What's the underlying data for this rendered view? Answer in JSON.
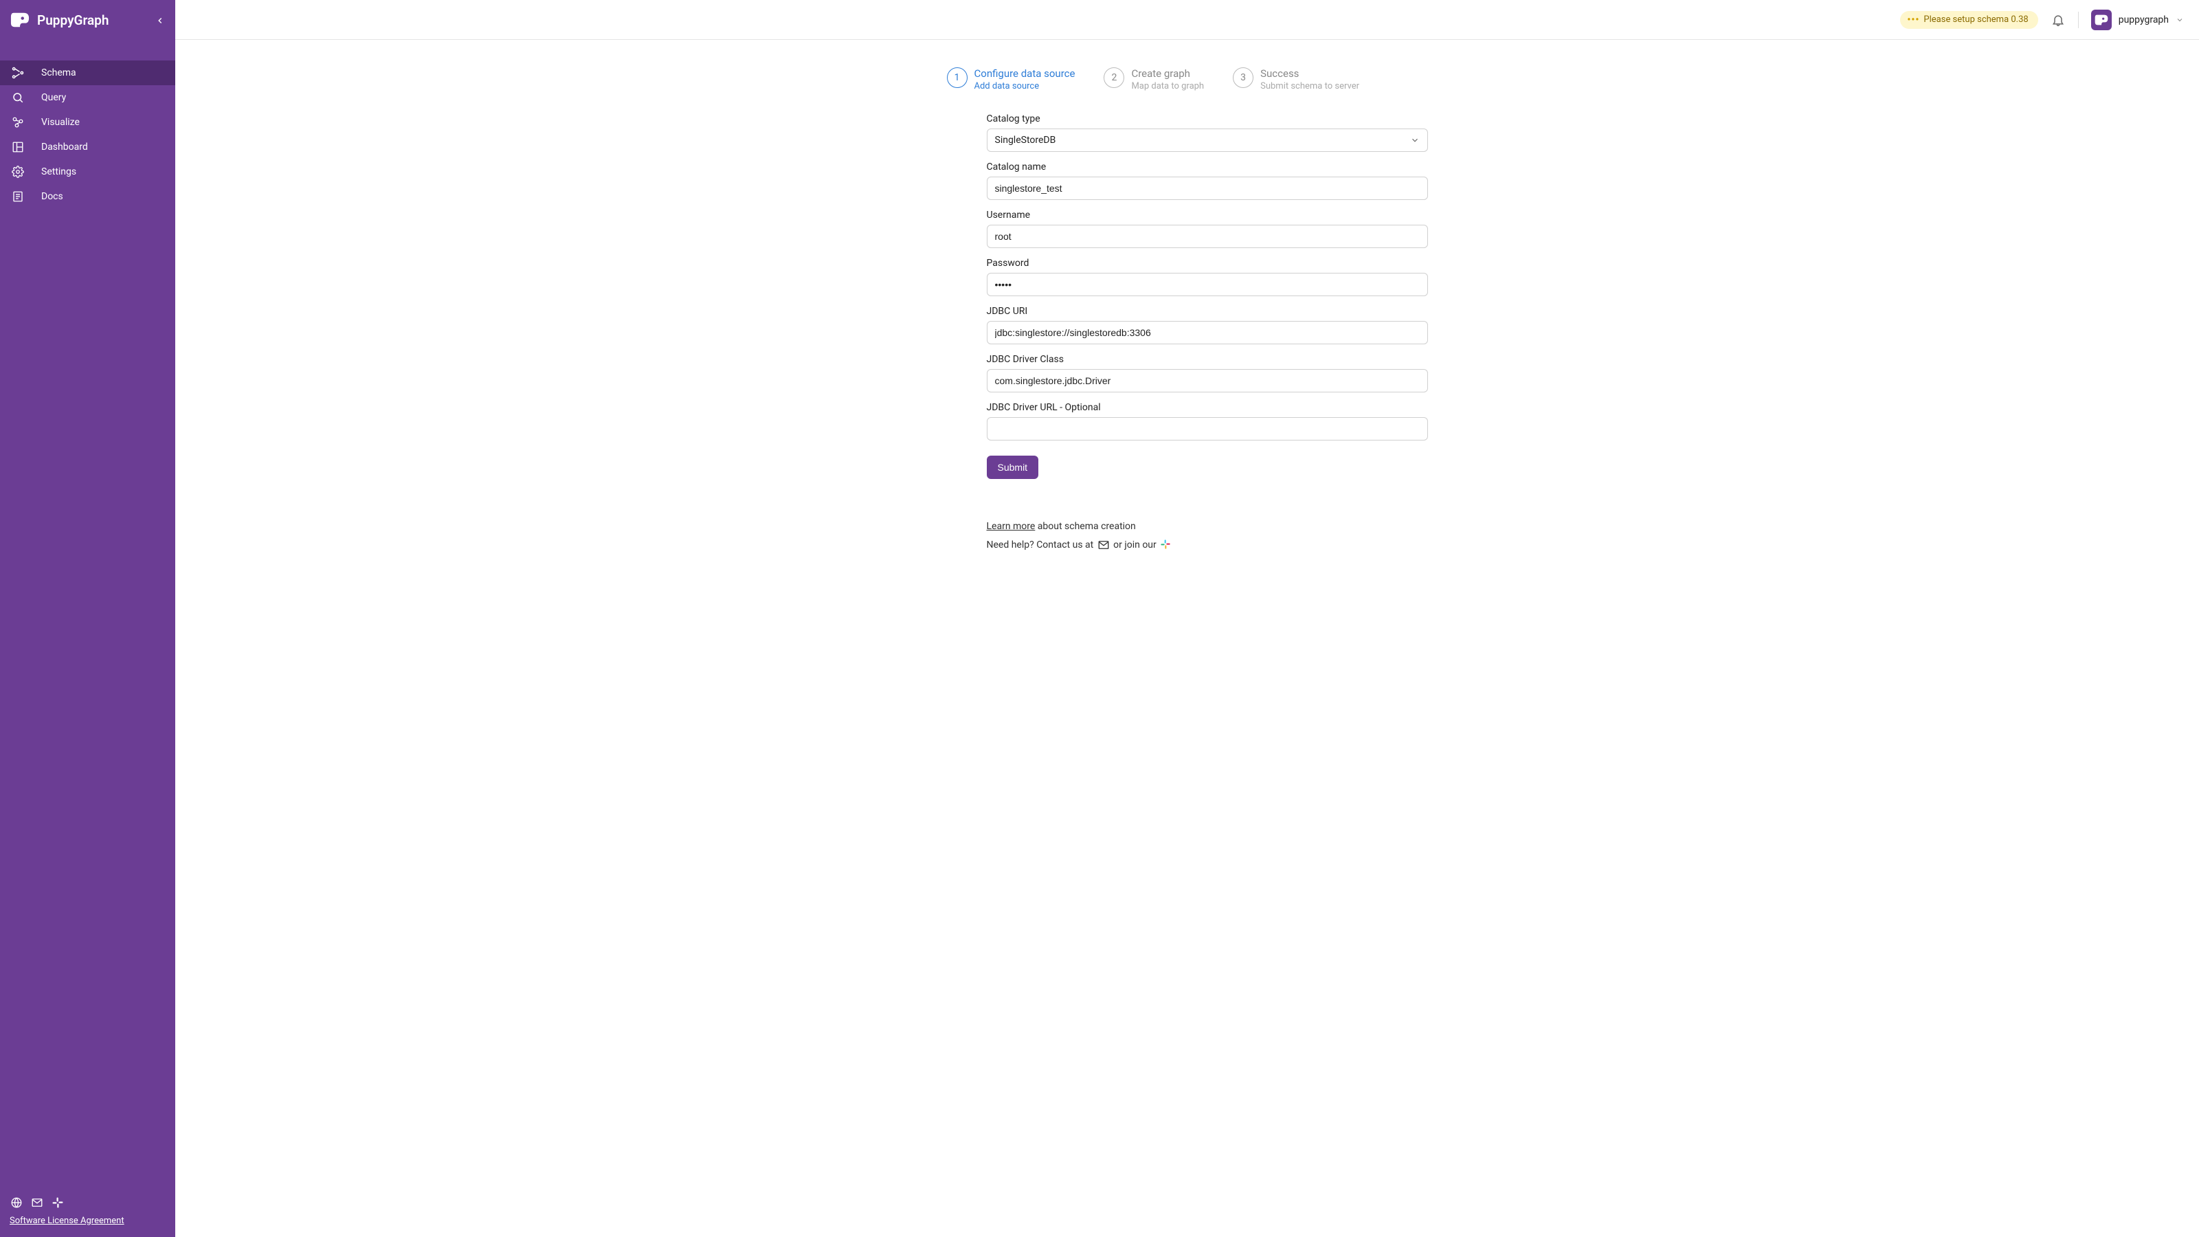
{
  "brand": {
    "name": "PuppyGraph"
  },
  "sidebar": {
    "items": [
      {
        "label": "Schema"
      },
      {
        "label": "Query"
      },
      {
        "label": "Visualize"
      },
      {
        "label": "Dashboard"
      },
      {
        "label": "Settings"
      },
      {
        "label": "Docs"
      }
    ],
    "license_link": "Software License Agreement"
  },
  "topbar": {
    "status": "Please setup schema 0.38",
    "username": "puppygraph"
  },
  "steps": [
    {
      "num": "1",
      "title": "Configure data source",
      "sub": "Add data source"
    },
    {
      "num": "2",
      "title": "Create graph",
      "sub": "Map data to graph"
    },
    {
      "num": "3",
      "title": "Success",
      "sub": "Submit schema to server"
    }
  ],
  "form": {
    "catalog_type_label": "Catalog type",
    "catalog_type_value": "SingleStoreDB",
    "catalog_name_label": "Catalog name",
    "catalog_name_value": "singlestore_test",
    "username_label": "Username",
    "username_value": "root",
    "password_label": "Password",
    "password_value": "•••••",
    "jdbc_uri_label": "JDBC URI",
    "jdbc_uri_value": "jdbc:singlestore://singlestoredb:3306",
    "driver_class_label": "JDBC Driver Class",
    "driver_class_value": "com.singlestore.jdbc.Driver",
    "driver_url_label": "JDBC Driver URL - Optional",
    "driver_url_value": "",
    "submit_label": "Submit"
  },
  "help": {
    "learn_more": "Learn more",
    "about": " about schema creation",
    "need_help": "Need help? Contact us at ",
    "or_join": " or join our "
  }
}
